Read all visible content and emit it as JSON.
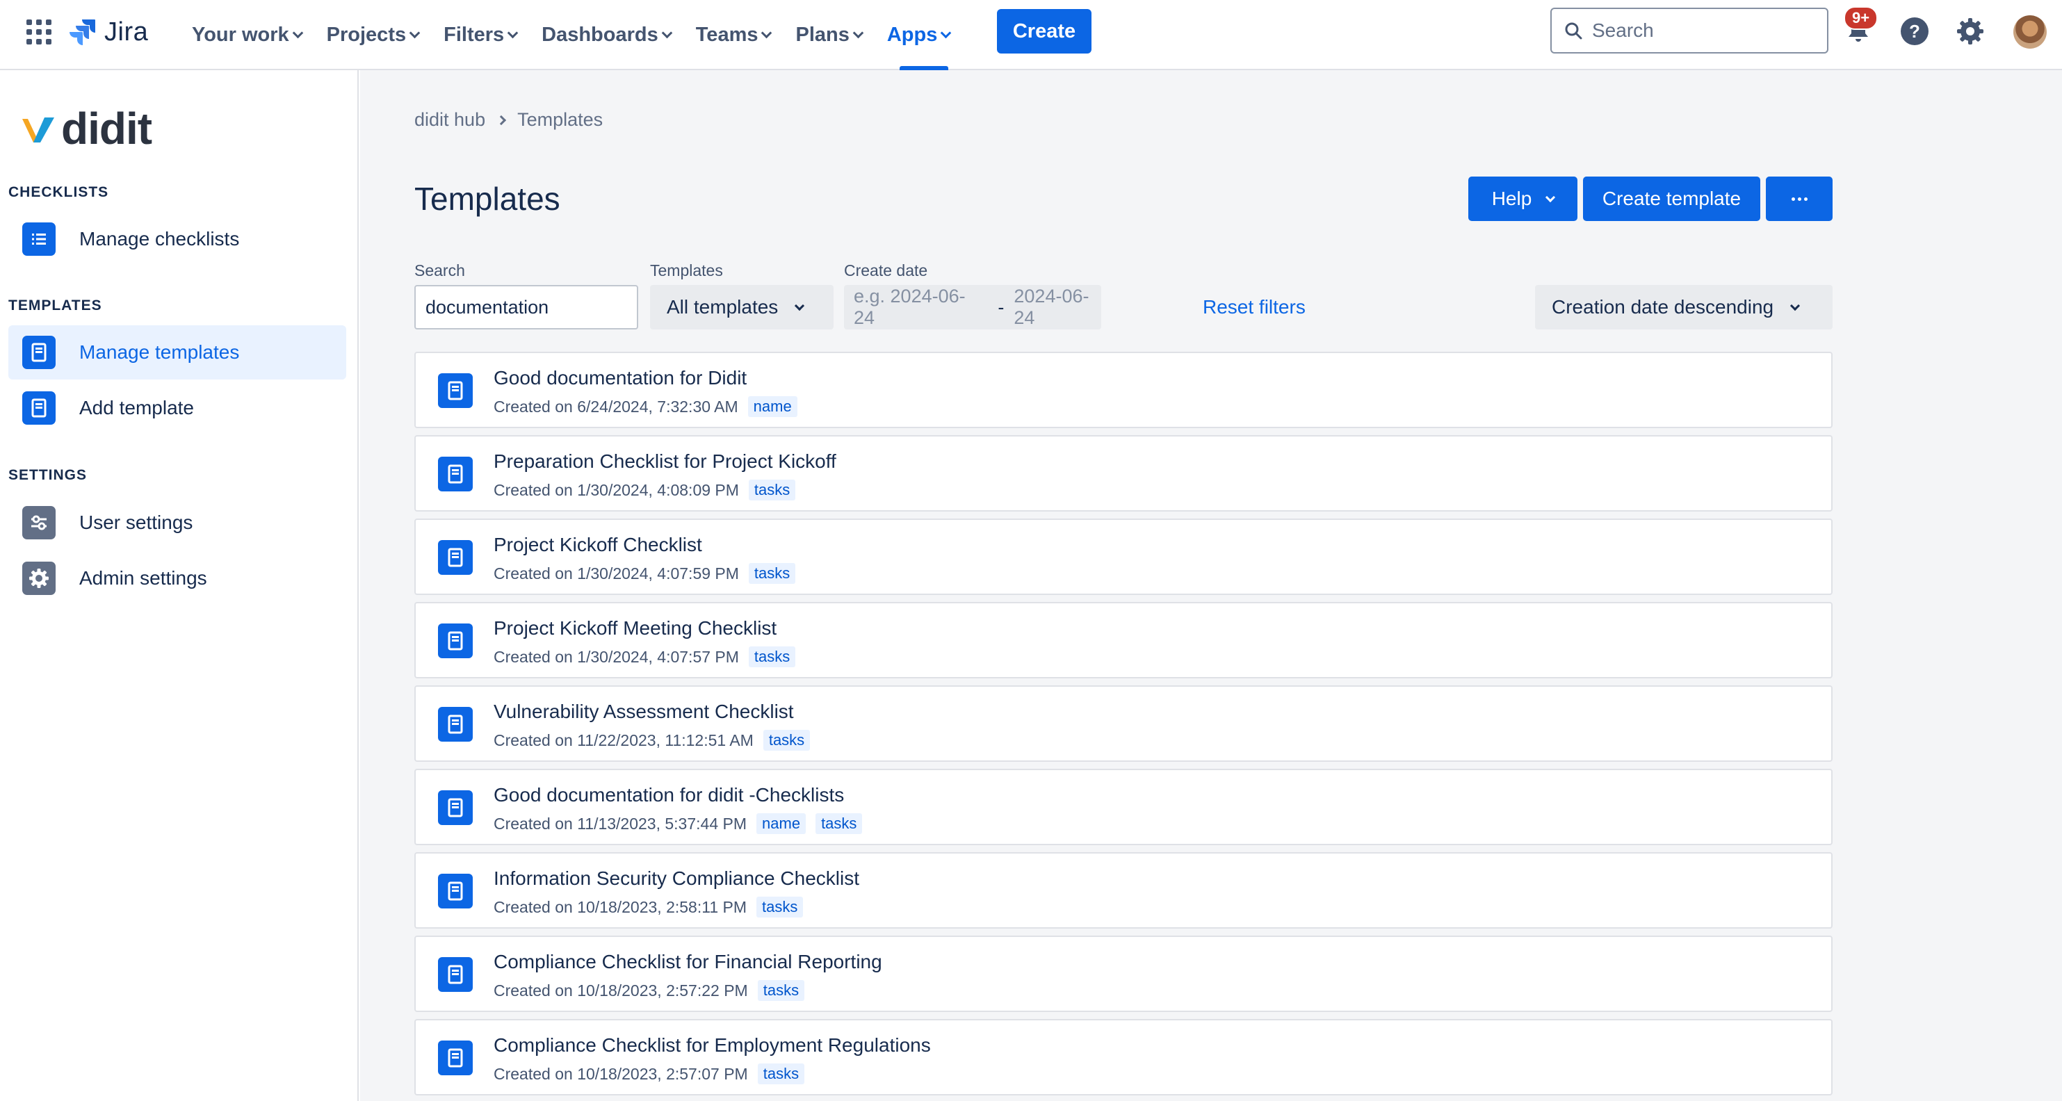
{
  "nav": {
    "product": "Jira",
    "items": [
      {
        "label": "Your work",
        "active": false
      },
      {
        "label": "Projects",
        "active": false
      },
      {
        "label": "Filters",
        "active": false
      },
      {
        "label": "Dashboards",
        "active": false
      },
      {
        "label": "Teams",
        "active": false
      },
      {
        "label": "Plans",
        "active": false
      },
      {
        "label": "Apps",
        "active": true
      }
    ],
    "create_label": "Create",
    "search_placeholder": "Search",
    "notification_count": "9+",
    "icons": [
      "app-switcher-icon",
      "jira-logo-icon",
      "search-icon",
      "notifications-icon",
      "help-icon",
      "settings-icon",
      "avatar"
    ]
  },
  "sidebar": {
    "brand": "didit",
    "sections": [
      {
        "title": "CHECKLISTS",
        "items": [
          {
            "label": "Manage checklists",
            "icon": "list-icon",
            "active": false
          }
        ]
      },
      {
        "title": "TEMPLATES",
        "items": [
          {
            "label": "Manage templates",
            "icon": "template-icon",
            "active": true
          },
          {
            "label": "Add template",
            "icon": "template-icon",
            "active": false
          }
        ]
      },
      {
        "title": "SETTINGS",
        "items": [
          {
            "label": "User settings",
            "icon": "sliders-icon",
            "active": false
          },
          {
            "label": "Admin settings",
            "icon": "gear-icon",
            "active": false
          }
        ]
      }
    ]
  },
  "main": {
    "breadcrumb": [
      "didit hub",
      "Templates"
    ],
    "title": "Templates",
    "buttons": {
      "help": "Help",
      "create_template": "Create template",
      "more": "more-icon"
    },
    "filters": {
      "search_label": "Search",
      "search_value": "documentation",
      "templates_label": "Templates",
      "templates_value": "All templates",
      "date_label": "Create date",
      "date_from_placeholder": "e.g. 2024-06-24",
      "date_to_placeholder": "2024-06-24",
      "date_separator": "-",
      "reset": "Reset filters",
      "sort_value": "Creation date descending"
    },
    "templates": [
      {
        "title": "Good documentation for Didit",
        "created": "Created on 6/24/2024, 7:32:30 AM",
        "tags": [
          "name"
        ]
      },
      {
        "title": "Preparation Checklist for Project Kickoff",
        "created": "Created on 1/30/2024, 4:08:09 PM",
        "tags": [
          "tasks"
        ]
      },
      {
        "title": "Project Kickoff Checklist",
        "created": "Created on 1/30/2024, 4:07:59 PM",
        "tags": [
          "tasks"
        ]
      },
      {
        "title": "Project Kickoff Meeting Checklist",
        "created": "Created on 1/30/2024, 4:07:57 PM",
        "tags": [
          "tasks"
        ]
      },
      {
        "title": "Vulnerability Assessment Checklist",
        "created": "Created on 11/22/2023, 11:12:51 AM",
        "tags": [
          "tasks"
        ]
      },
      {
        "title": "Good documentation for didit -Checklists",
        "created": "Created on 11/13/2023, 5:37:44 PM",
        "tags": [
          "name",
          "tasks"
        ]
      },
      {
        "title": "Information Security Compliance Checklist",
        "created": "Created on 10/18/2023, 2:58:11 PM",
        "tags": [
          "tasks"
        ]
      },
      {
        "title": "Compliance Checklist for Financial Reporting",
        "created": "Created on 10/18/2023, 2:57:22 PM",
        "tags": [
          "tasks"
        ]
      },
      {
        "title": "Compliance Checklist for Employment Regulations",
        "created": "Created on 10/18/2023, 2:57:07 PM",
        "tags": [
          "tasks"
        ]
      }
    ]
  },
  "colors": {
    "primary": "#0c66e4",
    "text": "#172b4d",
    "subtle": "#44546f",
    "page_bg": "#f4f5f7",
    "badge": "#c9372c",
    "brand_orange": "#f5a623",
    "brand_blue": "#1d9bd7"
  }
}
